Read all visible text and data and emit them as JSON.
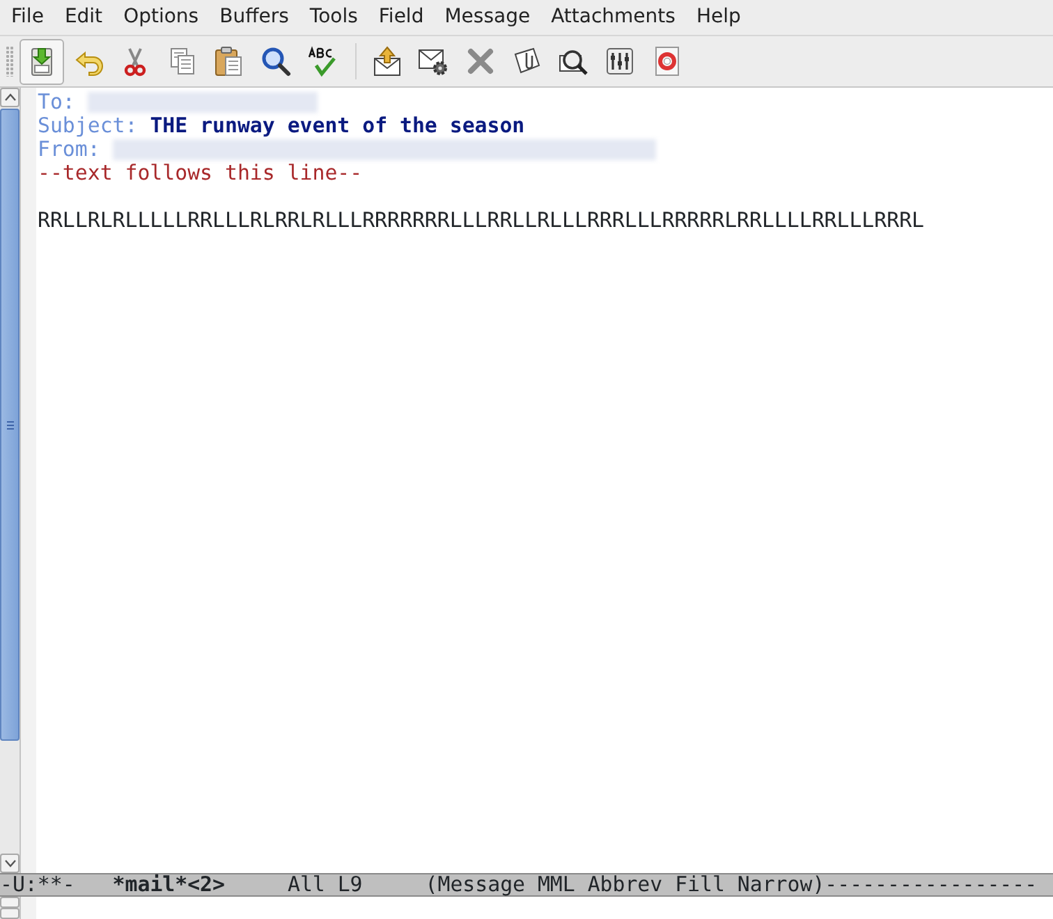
{
  "menu_bar": [
    "File",
    "Edit",
    "Options",
    "Buffers",
    "Tools",
    "Field",
    "Message",
    "Attachments",
    "Help"
  ],
  "toolbar": [
    {
      "kind": "button",
      "pressed": true
    },
    {
      "kind": "button",
      "pressed": false
    },
    {
      "kind": "button",
      "pressed": false
    },
    {
      "kind": "button",
      "pressed": false
    },
    {
      "kind": "button",
      "pressed": false
    },
    {
      "kind": "button",
      "pressed": false
    },
    {
      "kind": "button",
      "pressed": false
    },
    {
      "kind": "separator"
    },
    {
      "kind": "button",
      "pressed": false
    },
    {
      "kind": "button",
      "pressed": false
    },
    {
      "kind": "button",
      "pressed": false
    },
    {
      "kind": "button",
      "pressed": false
    },
    {
      "kind": "button",
      "pressed": false
    },
    {
      "kind": "button",
      "pressed": false
    },
    {
      "kind": "button",
      "pressed": false
    }
  ],
  "headers": [
    {
      "label": "To:",
      "redacted": true
    },
    {
      "label": "Subject:",
      "value": "THE runway event of the season",
      "redacted": false
    },
    {
      "label": "From:",
      "redacted": true
    }
  ],
  "separator_line": "--text follows this line--",
  "body": [
    "RRLLRLRLLLLLRRLLLRLRRLRLLLRRRRRRRLLLRRLLRLLLRRRLLLRRRRRLRRLLLLRRLLLRRRL"
  ],
  "mode_line": [
    {
      "text": "-U:**-",
      "bold": false
    },
    {
      "text": "*mail*<2>",
      "bold": true
    },
    {
      "text": "All L9",
      "bold": false
    },
    {
      "text": "(Message MML Abbrev Fill Narrow)",
      "bold": false
    },
    {
      "text": "-----------------",
      "bold": false
    }
  ]
}
